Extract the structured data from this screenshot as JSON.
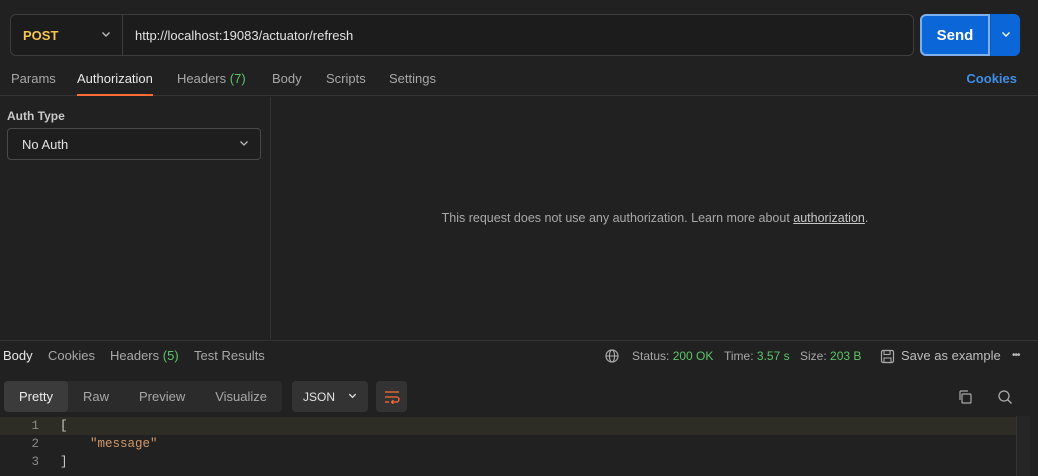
{
  "request": {
    "method": "POST",
    "url": "http://localhost:19083/actuator/refresh",
    "send_label": "Send"
  },
  "tabs": [
    {
      "label": "Params"
    },
    {
      "label": "Authorization"
    },
    {
      "label": "Headers",
      "count": "(7)"
    },
    {
      "label": "Body"
    },
    {
      "label": "Scripts"
    },
    {
      "label": "Settings"
    }
  ],
  "cookies_label": "Cookies",
  "auth": {
    "type_label": "Auth Type",
    "selected": "No Auth",
    "message_pre": "This request does not use any authorization. Learn more about ",
    "message_link": "authorization",
    "message_post": "."
  },
  "response": {
    "tabs": [
      {
        "label": "Body"
      },
      {
        "label": "Cookies"
      },
      {
        "label": "Headers",
        "count": "(5)"
      },
      {
        "label": "Test Results"
      }
    ],
    "status_label": "Status:",
    "status_value": "200 OK",
    "time_label": "Time:",
    "time_value": "3.57 s",
    "size_label": "Size:",
    "size_value": "203 B",
    "save_example": "Save as example",
    "more": "•••",
    "views": [
      "Pretty",
      "Raw",
      "Preview",
      "Visualize"
    ],
    "format": "JSON",
    "lines": [
      {
        "num": "1",
        "text": "["
      },
      {
        "num": "2",
        "text": "    \"message\""
      },
      {
        "num": "3",
        "text": "]"
      }
    ]
  },
  "colors": {
    "accent_tab": "#ff6c37",
    "send_button": "#0b67d8",
    "method_post": "#f5c451",
    "status_ok": "#5ec46a"
  },
  "icons": [
    "chevron-down-icon",
    "globe-icon",
    "save-icon",
    "wrap-lines-icon",
    "copy-icon",
    "search-icon"
  ]
}
